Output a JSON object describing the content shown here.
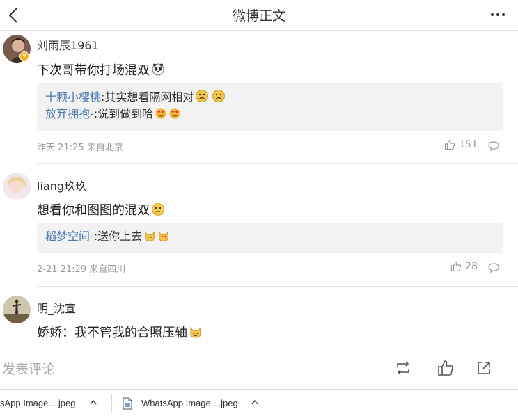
{
  "header": {
    "title": "微博正文"
  },
  "comments": [
    {
      "user": "刘雨辰1961",
      "verified": true,
      "text": "下次哥带你打场混双",
      "replies": [
        {
          "user": "十颗小樱桃",
          "text": ":其实想看隔网相对"
        },
        {
          "user": "放弃拥抱-",
          "text": ":说到做到哈"
        }
      ],
      "meta": "昨天 21:25 来自北京",
      "likes": "151"
    },
    {
      "user": "liang玖玖",
      "text": "想看你和图图的混双",
      "replies": [
        {
          "user": "稻梦空间-",
          "text": ":送你上去"
        }
      ],
      "meta": "2-21 21:29 来自四川",
      "likes": "28"
    },
    {
      "user": "明_沈宣",
      "text": "娇娇：我不管我的合照压轴"
    }
  ],
  "bottombar": {
    "placeholder": "发表评论"
  },
  "downloads": [
    {
      "name": "sApp Image....jpeg"
    },
    {
      "name": "WhatsApp Image....jpeg"
    }
  ],
  "colors": {
    "link": "#4b78b2",
    "meta": "#999999",
    "reply_bg": "#f2f2f2",
    "badge": "#f7b31b"
  },
  "icons": [
    "back-arrow-icon",
    "more-icon",
    "thumbs-up-icon",
    "comment-icon",
    "repost-icon",
    "share-icon",
    "file-icon",
    "chevron-up-icon"
  ]
}
